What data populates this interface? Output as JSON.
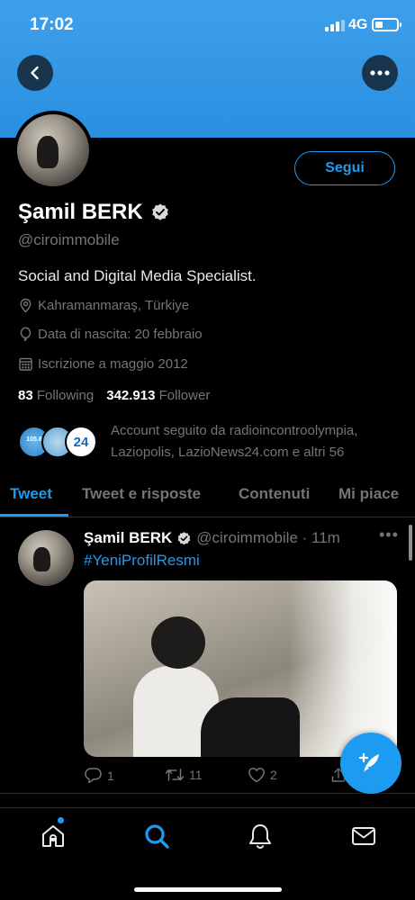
{
  "status_bar": {
    "time": "17:02",
    "network": "4G"
  },
  "profile": {
    "follow_label": "Segui",
    "name": "Şamil BERK",
    "handle": "@ciroimmobile",
    "bio": "Social and Digital Media Specialist.",
    "location": "Kahramanmaraş, Türkiye",
    "birthday": "Data di nascita: 20 febbraio",
    "joined": "Iscrizione a maggio 2012",
    "following_count": "83",
    "following_label": "Following",
    "followers_count": "342.913",
    "followers_label": "Follower",
    "followed_by": "Account seguito da radioincontroolympia, Laziopolis, LazioNews24.com e altri 56",
    "followed_avatar_text": "105.8"
  },
  "tabs": [
    {
      "label": "Tweet",
      "active": true
    },
    {
      "label": "Tweet e risposte",
      "active": false
    },
    {
      "label": "Contenuti",
      "active": false
    },
    {
      "label": "Mi piace",
      "active": false
    }
  ],
  "tweet": {
    "author": "Şamil BERK",
    "handle_time": "@ciroimmobile · 11m",
    "hashtag": "#YeniProfilResmi",
    "replies": "1",
    "retweets": "11",
    "likes": "2"
  },
  "icons": {
    "back": "chevron-left-icon",
    "more": "more-dots-icon",
    "verified": "verified-badge-icon",
    "location": "location-pin-icon",
    "birthday": "balloon-icon",
    "calendar": "calendar-icon",
    "compose": "compose-feather-icon",
    "home": "home-icon",
    "search": "search-icon",
    "notifications": "bell-icon",
    "messages": "mail-icon"
  },
  "colors": {
    "accent": "#1d9bf0",
    "banner": "#3ea0ec",
    "background": "#000000",
    "muted": "#71767b"
  }
}
